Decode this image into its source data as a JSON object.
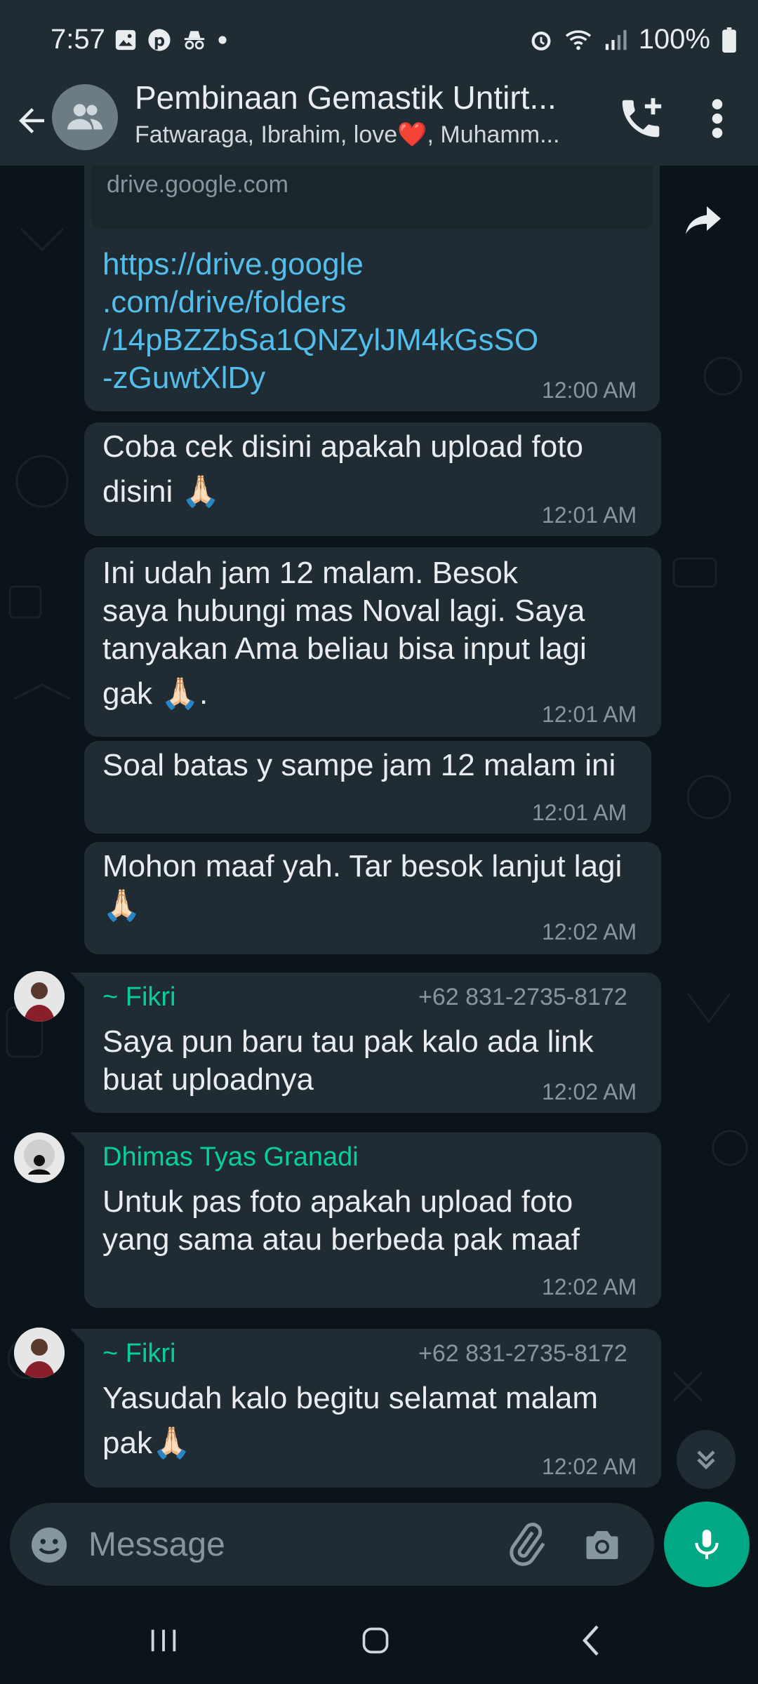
{
  "status_bar": {
    "time": "7:57",
    "battery": "100%",
    "icons_left": [
      "gallery-icon",
      "pinterest-icon",
      "incognito-icon",
      "dot-icon"
    ],
    "icons_right": [
      "alarm-icon",
      "wifi-icon",
      "signal-icon",
      "battery-icon"
    ]
  },
  "header": {
    "title": "Pembinaan Gemastik Untirt...",
    "subtitle": "Fatwaraga, Ibrahim, love❤️, Muhamm..."
  },
  "messages": [
    {
      "link_preview_domain": "drive.google.com",
      "link": "https://drive.google.com/drive/folders/14pBZZbSa1QNZylJM4kGsSO-zGuwtXlDy",
      "link_lines": [
        "https://drive.google",
        ".com/drive/folders",
        "/14pBZZbSa1QNZylJM4kGsSO",
        "-zGuwtXlDy"
      ],
      "time": "12:00 AM"
    },
    {
      "lines": [
        "Coba cek disini apakah upload foto",
        "disini 🙏🏻"
      ],
      "time": "12:01 AM"
    },
    {
      "lines": [
        "Ini udah jam 12 malam. Besok",
        "saya hubungi mas Noval lagi. Saya",
        "tanyakan Ama beliau bisa input lagi",
        "gak 🙏🏻."
      ],
      "time": "12:01 AM"
    },
    {
      "lines": [
        "Soal batas y sampe jam 12 malam ini"
      ],
      "time": "12:01 AM"
    },
    {
      "lines": [
        "Mohon maaf yah. Tar besok lanjut lagi",
        "🙏🏻"
      ],
      "time": "12:02 AM"
    },
    {
      "sender": "~ Fikri",
      "phone": "+62 831-2735-8172",
      "lines": [
        "Saya pun baru tau pak kalo ada link",
        "buat uploadnya"
      ],
      "time": "12:02 AM"
    },
    {
      "sender": "Dhimas Tyas Granadi",
      "lines": [
        "Untuk pas foto apakah upload foto",
        "yang sama atau berbeda pak maaf"
      ],
      "time": "12:02 AM"
    },
    {
      "sender": "~ Fikri",
      "phone": "+62 831-2735-8172",
      "lines": [
        "Yasudah kalo begitu selamat malam",
        "pak🙏🏻"
      ],
      "time": "12:02 AM"
    }
  ],
  "composer": {
    "placeholder": "Message"
  },
  "colors": {
    "accent": "#00a884",
    "sender": "#06cf9c",
    "bubble": "#202c33",
    "background": "#0b141a",
    "link": "#53bdeb"
  }
}
